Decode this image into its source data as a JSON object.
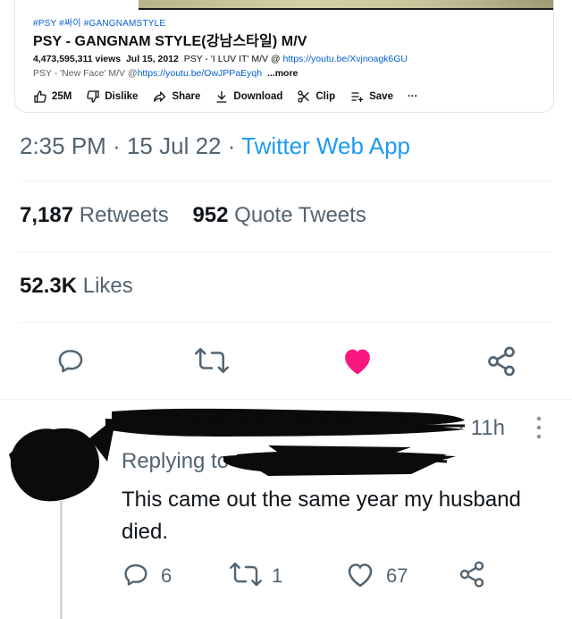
{
  "embed": {
    "tags": "#PSY #싸이 #GANGNAMSTYLE",
    "title": "PSY - GANGNAM STYLE(강남스타일) M/V",
    "views": "4,473,595,311 views",
    "date": "Jul 15, 2012",
    "desc_line1_text": "PSY - 'I LUV IT' M/V @",
    "desc_line1_link": "https://youtu.be/Xvjnoagk6GU",
    "desc_line2_text": "PSY - 'New Face' M/V @",
    "desc_line2_link": "https://youtu.be/OwJPPaEyqh",
    "more_label": "...more",
    "likes": "25M",
    "dislike_label": "Dislike",
    "share_label": "Share",
    "download_label": "Download",
    "clip_label": "Clip",
    "save_label": "Save",
    "overflow": "···"
  },
  "tweet": {
    "time": "2:35 PM",
    "date": "15 Jul 22",
    "separator": "·",
    "source": "Twitter Web App",
    "retweets_count": "7,187",
    "retweets_label": "Retweets",
    "quotes_count": "952",
    "quotes_label": "Quote Tweets",
    "likes_count": "52.3K",
    "likes_label": "Likes",
    "liked": true,
    "like_color": "#f91880"
  },
  "reply": {
    "time": "· 11h",
    "replying_prefix": "Replying to",
    "text": "This came out the same year my husband died.",
    "reply_count": "6",
    "retweet_count": "1",
    "like_count": "67"
  },
  "icons": {
    "reply": "reply-icon",
    "retweet": "retweet-icon",
    "like": "heart-icon",
    "share": "share-icon"
  }
}
